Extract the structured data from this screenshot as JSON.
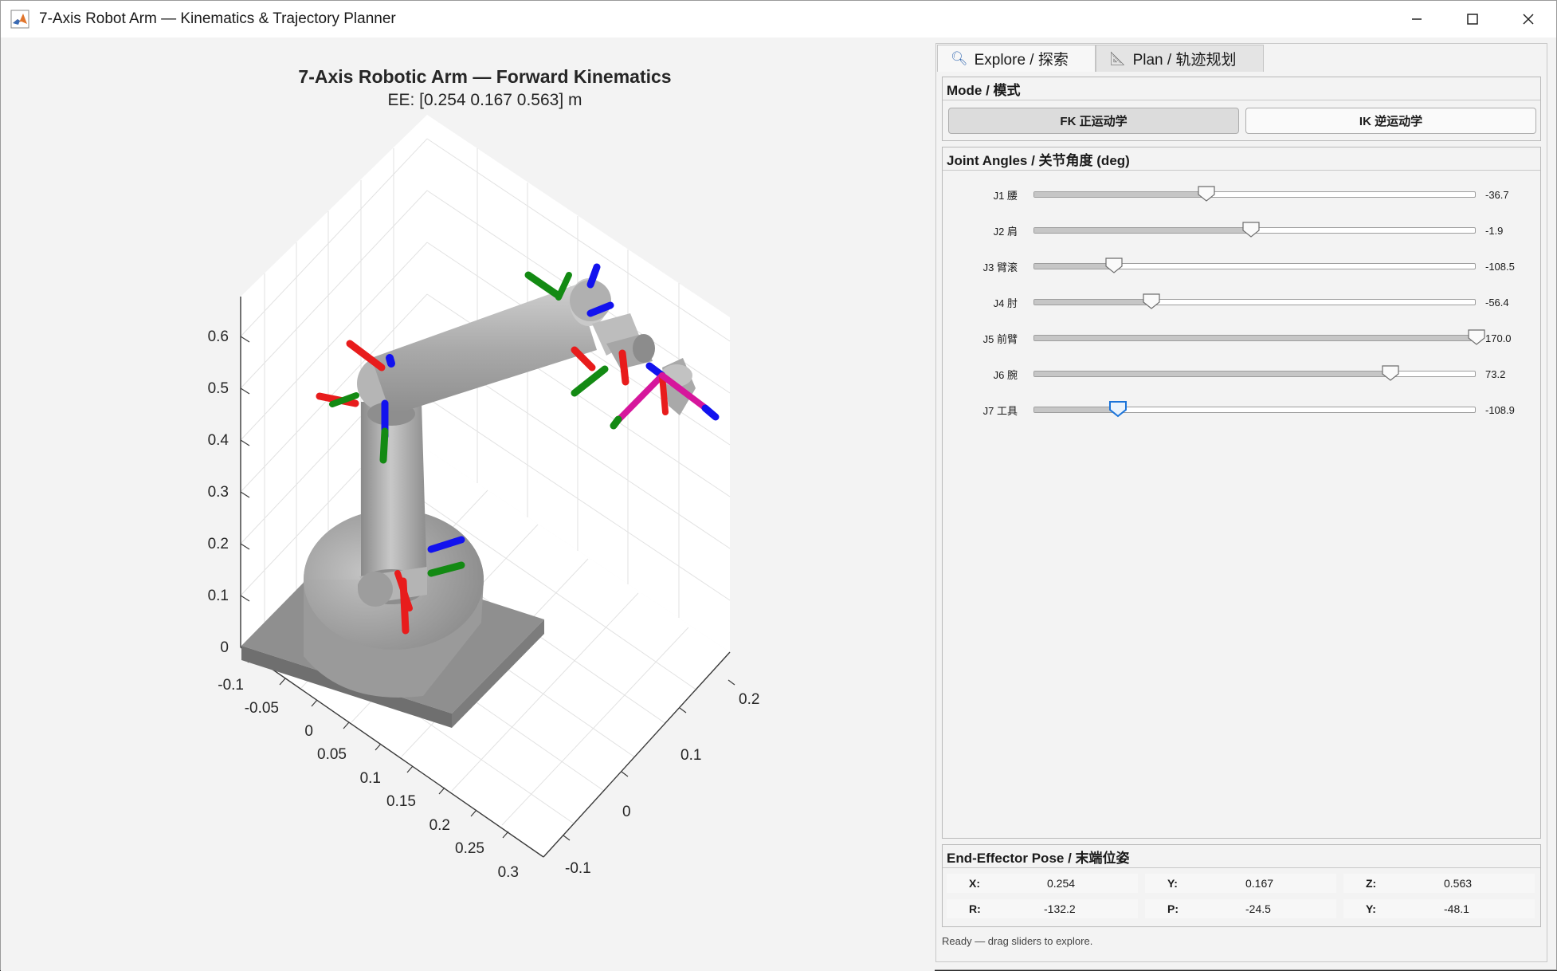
{
  "window": {
    "title": "7-Axis Robot Arm — Kinematics & Trajectory Planner",
    "controls": [
      "minimize",
      "maximize",
      "close"
    ]
  },
  "plot": {
    "title": "7-Axis Robotic Arm  —  Forward Kinematics",
    "subtitle": "EE: [0.254  0.167  0.563] m",
    "z_ticks": [
      "0",
      "0.1",
      "0.2",
      "0.3",
      "0.4",
      "0.5",
      "0.6"
    ],
    "x_ticks": [
      "-0.1",
      "-0.05",
      "0",
      "0.05",
      "0.1",
      "0.15",
      "0.2",
      "0.25",
      "0.3"
    ],
    "y_ticks": [
      "-0.1",
      "0",
      "0.1",
      "0.2"
    ],
    "colors": {
      "x_axis": "#e81c1c",
      "y_axis": "#138a13",
      "z_axis": "#1212ee",
      "tool": "#d6169c",
      "link": "#a8a8a8"
    }
  },
  "tabs": [
    {
      "label": "Explore / 探索",
      "icon": "search-icon",
      "active": true
    },
    {
      "label": "Plan / 轨迹规划",
      "icon": "ruler-icon",
      "active": false
    }
  ],
  "mode": {
    "title": "Mode / 模式",
    "fk_label": "FK 正运动学",
    "ik_label": "IK 逆运动学"
  },
  "joints": {
    "title": "Joint Angles / 关节角度 (deg)",
    "items": [
      {
        "label": "J1 腰",
        "value": "-36.7",
        "fraction": 0.39
      },
      {
        "label": "J2 肩",
        "value": "-1.9",
        "fraction": 0.49
      },
      {
        "label": "J3 臂滚",
        "value": "-108.5",
        "fraction": 0.18
      },
      {
        "label": "J4 肘",
        "value": "-56.4",
        "fraction": 0.265
      },
      {
        "label": "J5 前臂",
        "value": "170.0",
        "fraction": 1.0
      },
      {
        "label": "J6 腕",
        "value": "73.2",
        "fraction": 0.805
      },
      {
        "label": "J7 工具",
        "value": "-108.9",
        "fraction": 0.19
      }
    ]
  },
  "pose": {
    "title": "End-Effector Pose / 末端位姿",
    "x_key": "X:",
    "x_val": "0.254",
    "y_key": "Y:",
    "y_val": "0.167",
    "z_key": "Z:",
    "z_val": "0.563",
    "r_key": "R:",
    "r_val": "-132.2",
    "p_key": "P:",
    "p_val": "-24.5",
    "yaw_key": "Y:",
    "yaw_val": "-48.1"
  },
  "status": "Ready — drag sliders to explore."
}
